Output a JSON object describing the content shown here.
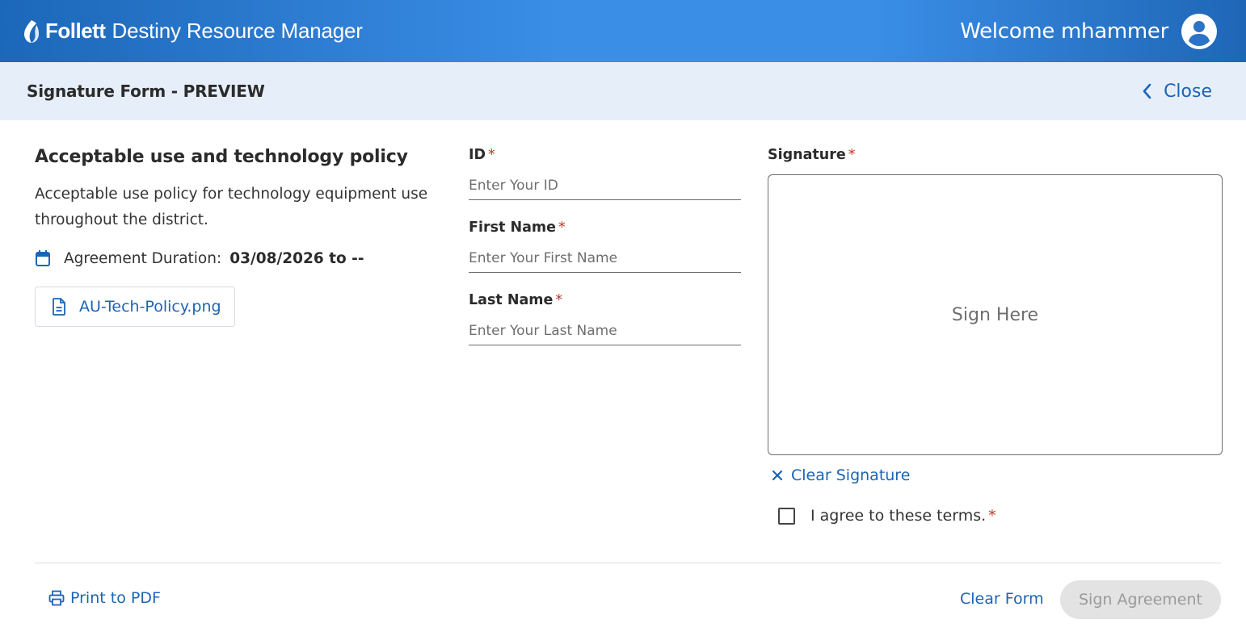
{
  "header": {
    "brand_name": "Follett",
    "brand_product": "Destiny Resource Manager",
    "welcome": "Welcome mhammer",
    "colors": {
      "bar_start": "#1c67b9",
      "bar_mid": "#3a8ee6"
    }
  },
  "subheader": {
    "title": "Signature Form - PREVIEW",
    "close_label": "Close"
  },
  "policy": {
    "title": "Acceptable use and technology policy",
    "description": "Acceptable use policy for technology equipment use throughout the district.",
    "duration_label": "Agreement Duration:",
    "duration_value": "03/08/2026 to --",
    "file_name": "AU-Tech-Policy.png"
  },
  "form": {
    "id": {
      "label": "ID",
      "required_mark": "*",
      "placeholder": "Enter Your ID",
      "value": ""
    },
    "first_name": {
      "label": "First Name",
      "required_mark": "*",
      "placeholder": "Enter Your First Name",
      "value": ""
    },
    "last_name": {
      "label": "Last Name",
      "required_mark": "*",
      "placeholder": "Enter Your Last Name",
      "value": ""
    }
  },
  "signature": {
    "label": "Signature",
    "required_mark": "*",
    "pad_placeholder": "Sign Here",
    "clear_label": "Clear Signature",
    "agree_label": "I agree to these terms.",
    "agree_required_mark": "*",
    "agree_checked": false
  },
  "footer": {
    "print_label": "Print to PDF",
    "clear_form_label": "Clear Form",
    "sign_label": "Sign Agreement"
  },
  "colors": {
    "accent": "#1c64b5",
    "required": "#c0392b",
    "subheader_bg": "#e6eef9"
  }
}
